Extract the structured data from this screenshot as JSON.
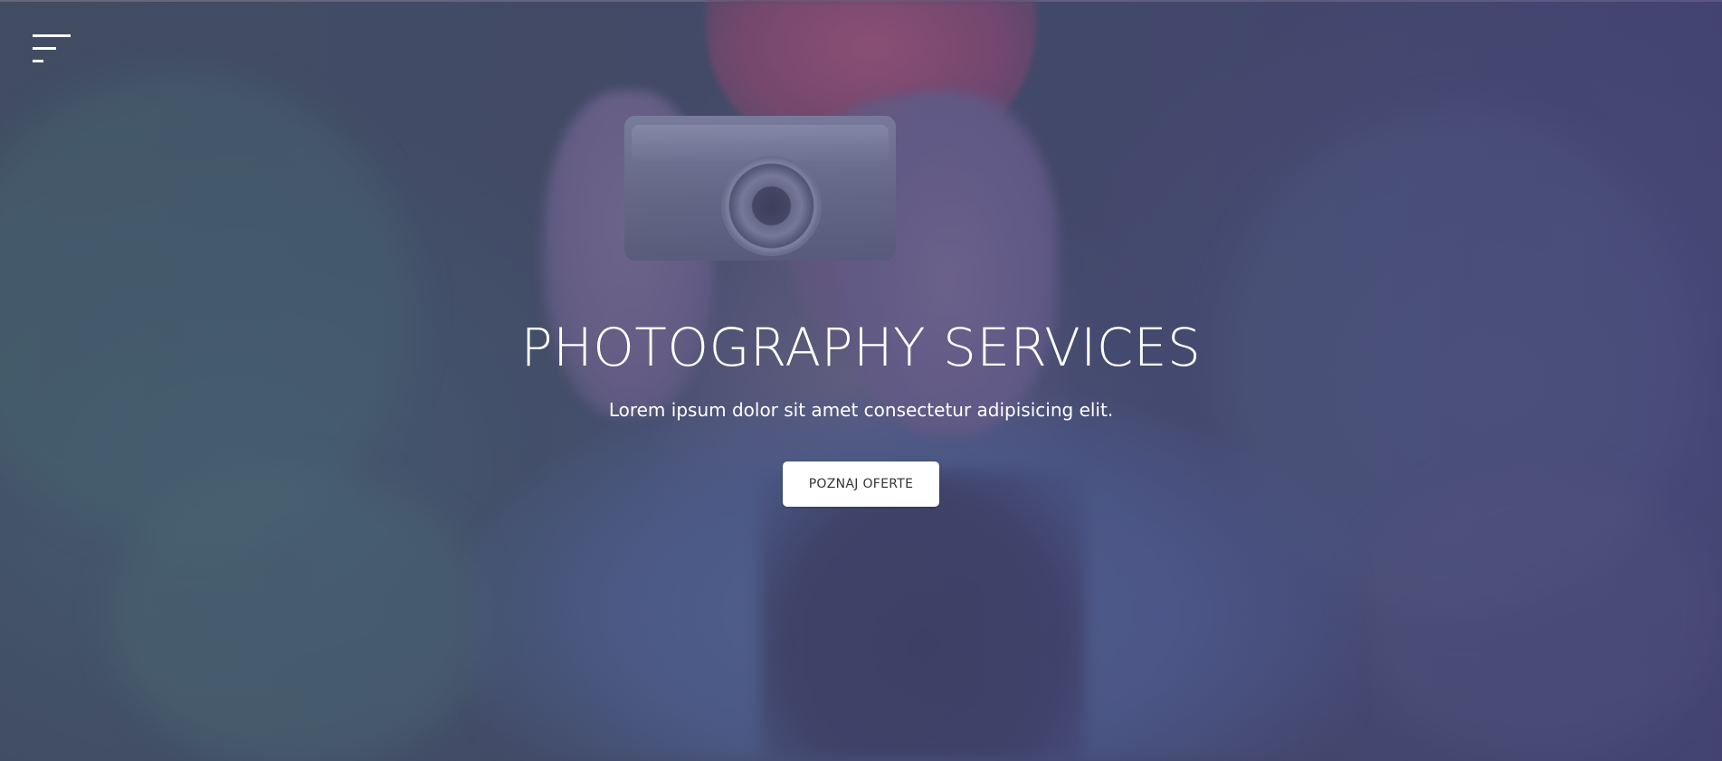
{
  "hero": {
    "title": "PHOTOGRAPHY SERVICES",
    "subtitle": "Lorem ipsum dolor sit amet consectetur adipisicing elit.",
    "cta_label": "POZNAJ OFERTE"
  },
  "icons": {
    "menu": "hamburger-menu-icon"
  },
  "colors": {
    "overlay": "#5a5a8c",
    "text": "#ffffff",
    "button_bg": "#ffffff",
    "button_text": "#333333"
  }
}
